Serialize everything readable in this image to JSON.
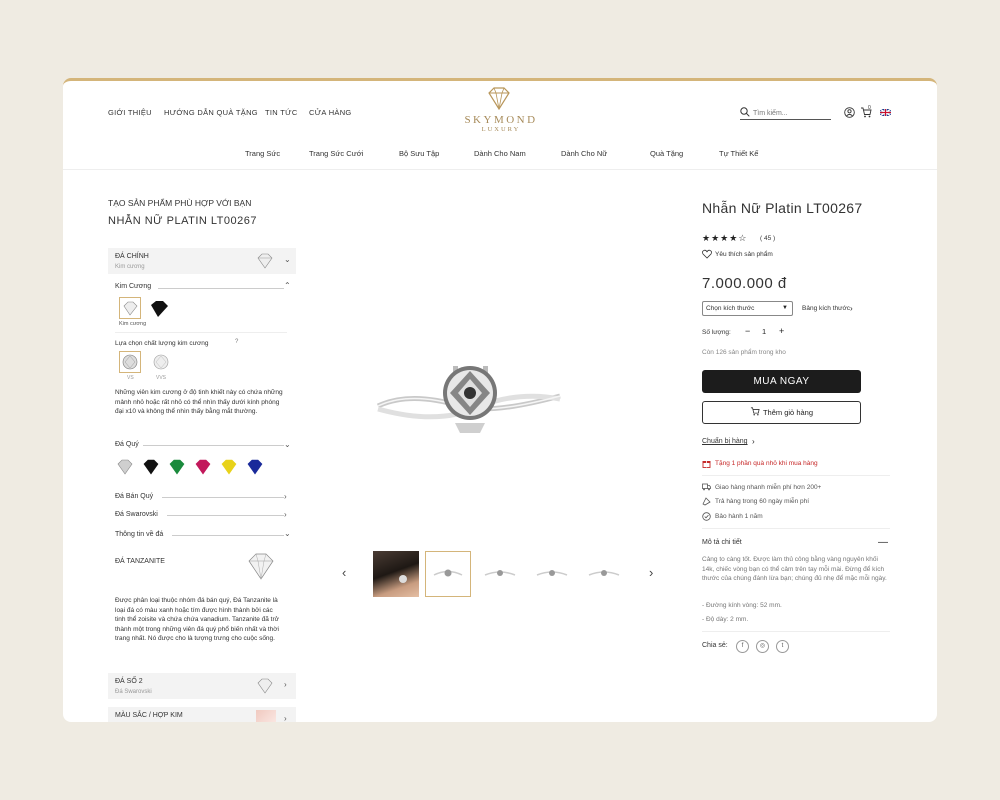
{
  "header": {
    "nav_left": [
      "GIỚI THIỆU",
      "HƯỚNG DẪN QUÀ TẶNG",
      "TIN TỨC",
      "CỬA HÀNG"
    ],
    "logo_text": "SKYMOND",
    "logo_sub": "LUXURY",
    "search_placeholder": "Tìm kiếm...",
    "cart_count": "0",
    "categories": [
      "Trang Sức",
      "Trang Sức Cưới",
      "Bộ Sưu Tập",
      "Dành Cho Nam",
      "Dành Cho Nữ",
      "Quà Tặng",
      "Tự Thiết Kế"
    ]
  },
  "configurator": {
    "heading": "TẠO SẢN PHẨM PHÙ HỢP VỚI BẠN",
    "product_title": "NHẪN NỮ PLATIN LT00267",
    "main_stone": {
      "label": "ĐÁ CHÍNH",
      "value": "Kim cương"
    },
    "diamond_section": "Kim Cương",
    "diamond_option_label": "Kim cương",
    "quality_label": "Lựa chọn chất lượng kim cương",
    "quality_options": [
      "VS",
      "VVS"
    ],
    "diamond_desc": "Những viên kim cương ở độ tinh khiết này có chứa những mảnh nhỏ hoặc rất nhỏ có thể nhìn thấy dưới kính phóng đại x10 và không thể nhìn thấy bằng mắt thường.",
    "gemstone_section": "Đá Quý",
    "semi_precious_section": "Đá Bán Quý",
    "swarovski_section": "Đá Swarovski",
    "stone_info_section": "Thông tin về đá",
    "tanzanite_title": "ĐÁ TANZANITE",
    "tanzanite_desc": "Được phân loại thuộc nhóm đá bán quý, Đá Tanzanite là loại đá có màu xanh hoặc tím được hình thành bởi các tinh thể zoisite và chứa chứa vanadium. Tanzanite đã trở thành một trong những viên đá quý phổ biến nhất và thời trang nhất. Nó được cho là tượng trưng cho cuộc sống.",
    "stone2": {
      "label": "ĐÁ SỐ 2",
      "value": "Đá Swarovski"
    },
    "metal_label": "MÀU SẮC / HỢP KIM"
  },
  "gem_colors": [
    "#cfcfcf",
    "#111111",
    "#1a8a3c",
    "#c2185b",
    "#e8d21a",
    "#1a2a9a"
  ],
  "product": {
    "name": "Nhẫn Nữ Platin LT00267",
    "rating": 4,
    "review_count": "( 45 )",
    "favorite": "Yêu thích sản phẩm",
    "price": "7.000.000 đ",
    "size_select": "Chọn kích thước",
    "size_guide": "Bảng kích thước",
    "qty_label": "Số lượng:",
    "qty_minus": "−",
    "qty_value": "1",
    "qty_plus": "+",
    "stock": "Còn 126 sản phẩm trong kho",
    "buy_now": "MUA NGAY",
    "add_to_cart": "Thêm giỏ hàng",
    "standard_size": "Chuẩn bị hàng",
    "gift_promo": "Tặng 1 phần quà nhỏ khi mua hàng",
    "shipping": "Giao hàng nhanh miễn phí hơn 200+",
    "returns": "Trả hàng trong 60 ngày miễn phí",
    "warranty": "Bảo hành 1 năm",
    "details_title": "Mô tả chi tiết",
    "details_text": "Cảng to càng tốt. Được làm thủ công bằng vàng nguyên khối 14k, chiếc vòng bạn có thể cảm trên tay mỗi mài. Đừng để kích thước của chúng đánh lừa bạn; chúng đủ nhẹ để mặc mỗi ngày.",
    "spec_1": "- Đường kính vòng: 52 mm.",
    "spec_2": "- Độ dày: 2 mm.",
    "share_label": "Chia sẻ:"
  },
  "gallery": {
    "prev": "‹",
    "next": "›"
  }
}
